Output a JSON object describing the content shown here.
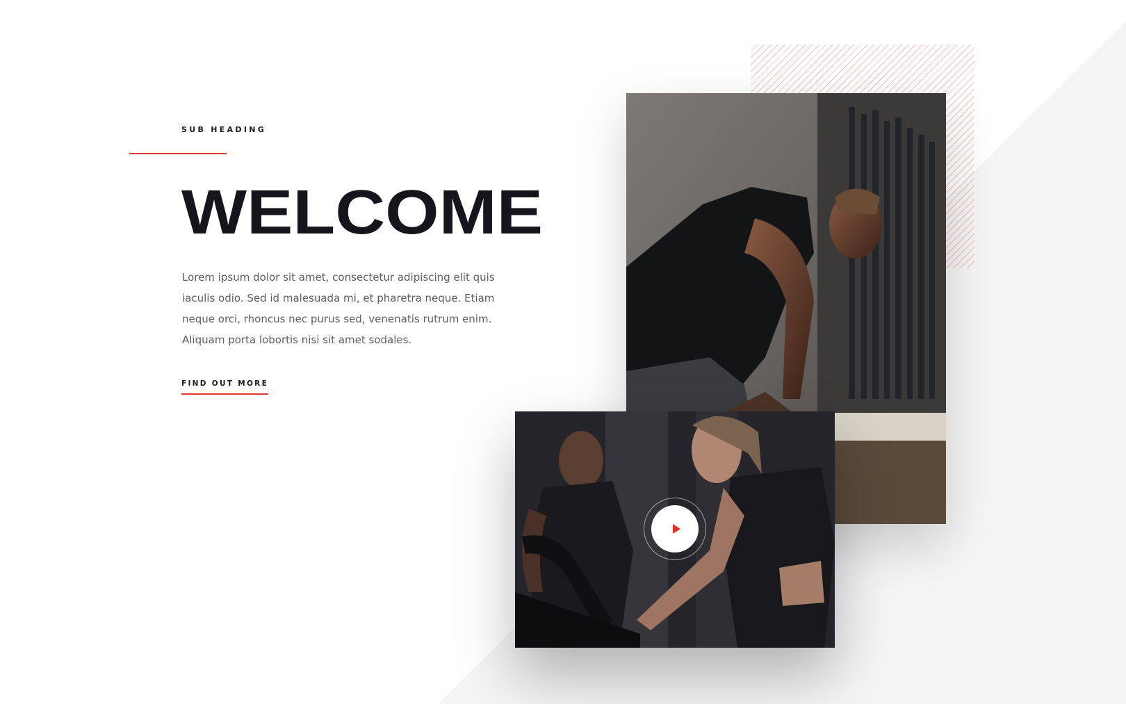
{
  "colors": {
    "accent": "#e03a2f",
    "heading": "#15151b",
    "body_text": "#5e5e64",
    "diagonal_bg": "#f5f5f6",
    "play_icon": "#e53127"
  },
  "hero": {
    "sub_heading": "SUB HEADING",
    "title": "WELCOME",
    "body": "Lorem ipsum dolor sit amet, consectetur adipiscing elit quis iaculis odio. Sed id malesuada mi, et pharetra neque. Etiam neque orci, rhoncus nec purus sed, venenatis rutrum enim. Aliquam porta lobortis nisi sit amet sodales.",
    "cta_label": "FIND OUT MORE"
  },
  "media": {
    "photo_top_icon": "athlete-photo",
    "photo_bottom_icon": "cycling-class-photo",
    "play_icon": "play-icon"
  }
}
